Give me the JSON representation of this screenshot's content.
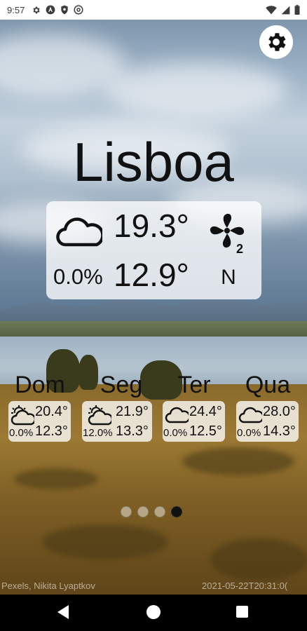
{
  "status_bar": {
    "time": "9:57",
    "icons": [
      "gear-icon",
      "a-icon",
      "shield-icon",
      "at-icon"
    ],
    "right_icons": [
      "wifi-icon",
      "signal-icon",
      "battery-icon"
    ]
  },
  "city": "Lisboa",
  "current": {
    "icon": "cloud-icon",
    "temp_max": "19.3°",
    "temp_min": "12.9°",
    "precipitation": "0.0%",
    "wind_icon": "wind-fan-icon",
    "wind_force": "2",
    "wind_direction": "N"
  },
  "forecast": [
    {
      "day": "Dom",
      "icon": "partly-sunny-icon",
      "temp_max": "20.4°",
      "temp_min": "12.3°",
      "precipitation": "0.0%"
    },
    {
      "day": "Seg",
      "icon": "partly-sunny-icon",
      "temp_max": "21.9°",
      "temp_min": "13.3°",
      "precipitation": "12.0%"
    },
    {
      "day": "Ter",
      "icon": "cloud-icon",
      "temp_max": "24.4°",
      "temp_min": "12.5°",
      "precipitation": "0.0%"
    },
    {
      "day": "Qua",
      "icon": "cloud-icon",
      "temp_max": "28.0°",
      "temp_min": "14.3°",
      "precipitation": "0.0%"
    }
  ],
  "pager": {
    "count": 4,
    "active_index": 3
  },
  "photo_credit": "Pexels, Nikita Lyaptkov",
  "timestamp": "2021-05-22T20:31:0(",
  "navigation": {
    "back": "back-icon",
    "home": "home-icon",
    "recents": "recents-icon"
  }
}
